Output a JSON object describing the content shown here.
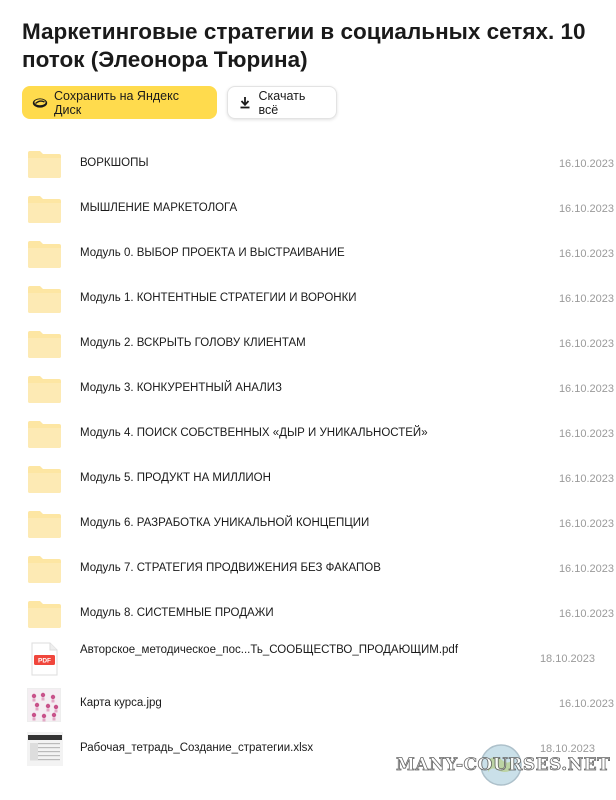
{
  "title": "Маркетинговые стратегии в социальных сетях. 10 поток (Элеонора Тюрина)",
  "actions": {
    "save_label": "Сохранить на Яндекс Диск",
    "download_label": "Скачать всё"
  },
  "colors": {
    "accent": "#ffdb4d",
    "folder": "#fde6a3",
    "pdf_badge": "#f0463c"
  },
  "items": [
    {
      "type": "folder",
      "name": "ВОРКШОПЫ",
      "date": "16.10.2023"
    },
    {
      "type": "folder",
      "name": "МЫШЛЕНИЕ МАРКЕТОЛОГА",
      "date": "16.10.2023"
    },
    {
      "type": "folder",
      "name": "Модуль 0. ВЫБОР ПРОЕКТА И ВЫСТРАИВАНИЕ",
      "date": "16.10.2023"
    },
    {
      "type": "folder",
      "name": "Модуль 1. КОНТЕНТНЫЕ СТРАТЕГИИ И ВОРОНКИ",
      "date": "16.10.2023"
    },
    {
      "type": "folder",
      "name": "Модуль 2. ВСКРЫТЬ ГОЛОВУ КЛИЕНТАМ",
      "date": "16.10.2023"
    },
    {
      "type": "folder",
      "name": "Модуль 3. КОНКУРЕНТНЫЙ АНАЛИЗ",
      "date": "16.10.2023"
    },
    {
      "type": "folder",
      "name": "Модуль 4. ПОИСК СОБСТВЕННЫХ «ДЫР И УНИКАЛЬНОСТЕЙ»",
      "date": "16.10.2023"
    },
    {
      "type": "folder",
      "name": "Модуль 5. ПРОДУКТ НА МИЛЛИОН",
      "date": "16.10.2023"
    },
    {
      "type": "folder",
      "name": "Модуль 6. РАЗРАБОТКА УНИКАЛЬНОЙ КОНЦЕПЦИИ",
      "date": "16.10.2023"
    },
    {
      "type": "folder",
      "name": "Модуль 7. СТРАТЕГИЯ ПРОДВИЖЕНИЯ БЕЗ ФАКАПОВ",
      "date": "16.10.2023"
    },
    {
      "type": "folder",
      "name": "Модуль 8. СИСТЕМНЫЕ ПРОДАЖИ",
      "date": "16.10.2023"
    },
    {
      "type": "pdf",
      "name": "Авторское_методическое_пос...Ть_СООБЩЕСТВО_ПРОДАЮЩИМ.pdf",
      "date": "18.10.2023",
      "badge": "PDF"
    },
    {
      "type": "image",
      "name": "Карта курса.jpg",
      "date": "16.10.2023"
    },
    {
      "type": "xlsx",
      "name": "Рабочая_тетрадь_Создание_стратегии.xlsx",
      "date": "18.10.2023"
    }
  ],
  "watermark": "MANY-COURSES.NET"
}
